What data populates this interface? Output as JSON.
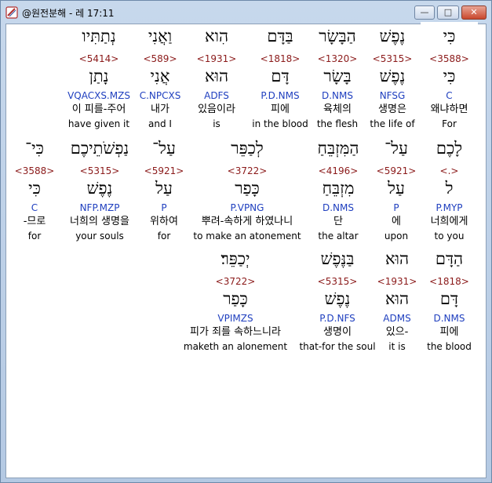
{
  "window": {
    "title": "@원전분해 - 레 17:11",
    "minimize": "—",
    "maximize": "□",
    "close": "✕"
  },
  "rows": [
    {
      "words": [
        {
          "heb": "כִּי",
          "strong": "<3588>",
          "lemma": "כִּי",
          "parse": "C",
          "kor": "왜냐하면",
          "eng": "For",
          "selected": true
        },
        {
          "heb": "נֶפֶשׁ",
          "strong": "<5315>",
          "lemma": "נֶפֶשׁ",
          "parse": "NFSG",
          "kor": "생명은",
          "eng": "the life of"
        },
        {
          "heb": "הַבָּשָׂר",
          "strong": "<1320>",
          "lemma": "בָּשָׂר",
          "parse": "D.NMS",
          "kor": "육체의",
          "eng": "the flesh"
        },
        {
          "heb": "בַּדָּם",
          "strong": "<1818>",
          "lemma": "דָּם",
          "parse": "P.D.NMS",
          "kor": "피에",
          "eng": "in the blood"
        },
        {
          "heb": "הִוא",
          "strong": "<1931>",
          "lemma": "הוּא",
          "parse": "ADFS",
          "kor": "있음이라",
          "eng": "is"
        },
        {
          "heb": "וַאֲנִי",
          "strong": "<589>",
          "lemma": "אֲנִי",
          "parse": "C.NPCXS",
          "kor": "내가",
          "eng": "and I"
        },
        {
          "heb": "נְתַתִּיו",
          "strong": "<5414>",
          "lemma": "נָתַן",
          "parse": "VQACXS.MZS",
          "kor": "이 피를-주어",
          "eng": "have given it"
        }
      ]
    },
    {
      "words": [
        {
          "heb": "לָכֶם",
          "strong": "<.>",
          "lemma": "ל",
          "parse": "P.MYP",
          "kor": "너희에게",
          "eng": "to you"
        },
        {
          "heb": "עַל־",
          "strong": "<5921>",
          "lemma": "עַל",
          "parse": "P",
          "kor": "에",
          "eng": "upon"
        },
        {
          "heb": "הַמִּזְבֵּחַ",
          "strong": "<4196>",
          "lemma": "מִזְבֵּחַ",
          "parse": "D.NMS",
          "kor": "단",
          "eng": "the altar"
        },
        {
          "heb": "לְכַפֵּר",
          "strong": "<3722>",
          "lemma": "כָּפַר",
          "parse": "P.VPNG",
          "kor": "뿌려-속하게 하였나니",
          "eng": "to make an atonement"
        },
        {
          "heb": "עַל־",
          "strong": "<5921>",
          "lemma": "עַל",
          "parse": "P",
          "kor": "위하여",
          "eng": "for"
        },
        {
          "heb": "נַפְשֹׁתֵיכֶם",
          "strong": "<5315>",
          "lemma": "נֶפֶשׁ",
          "parse": "NFP.MZP",
          "kor": "너희의 생명을",
          "eng": "your souls"
        },
        {
          "heb": "כִּי־",
          "strong": "<3588>",
          "lemma": "כִּי",
          "parse": "C",
          "kor": "-므로",
          "eng": "for"
        }
      ]
    },
    {
      "words": [
        {
          "heb": "הַדָּם",
          "strong": "<1818>",
          "lemma": "דָּם",
          "parse": "D.NMS",
          "kor": "피에",
          "eng": "the blood"
        },
        {
          "heb": "הוּא",
          "strong": "<1931>",
          "lemma": "הוּא",
          "parse": "ADMS",
          "kor": "있으-",
          "eng": "it is"
        },
        {
          "heb": "בַּנֶּפֶשׁ",
          "strong": "<5315>",
          "lemma": "נֶפֶשׁ",
          "parse": "P.D.NFS",
          "kor": "생명이",
          "eng": "that-for the soul"
        },
        {
          "heb": "יְכַפֵּר׃",
          "strong": "<3722>",
          "lemma": "כָּפַר",
          "parse": "VPIMZS",
          "kor": "피가 죄를 속하느니라",
          "eng": "maketh an alonement"
        }
      ]
    }
  ]
}
